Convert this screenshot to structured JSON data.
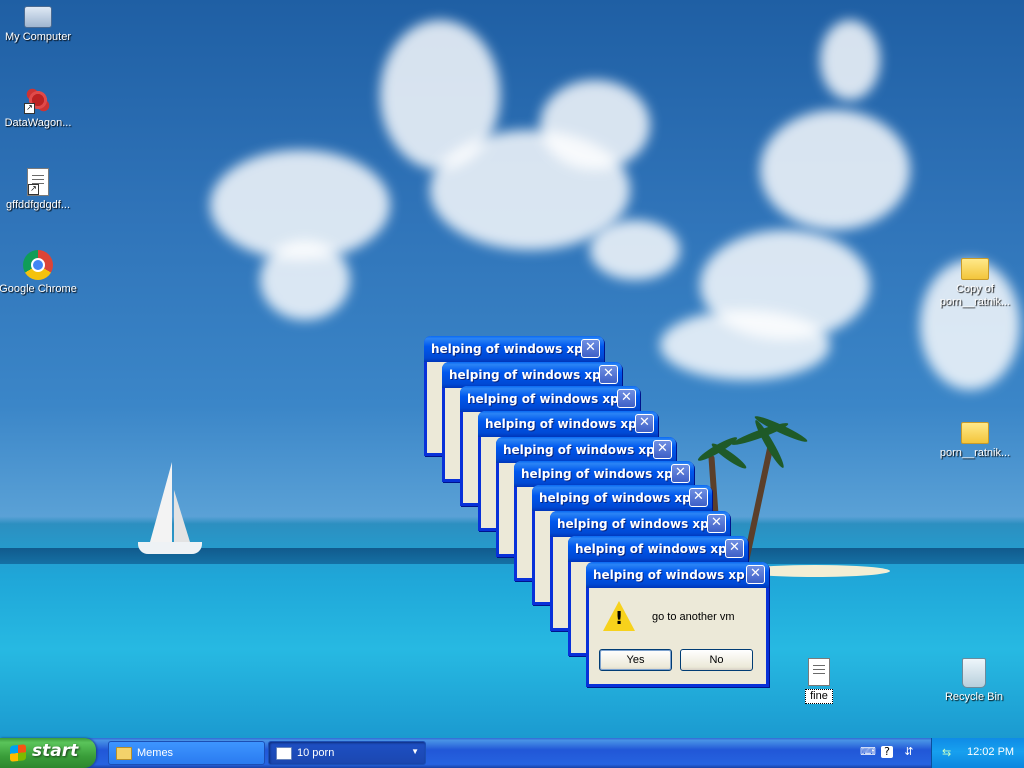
{
  "desktop": {
    "icons": [
      {
        "label": "My Computer",
        "icon": "computer-icon"
      },
      {
        "label": "DataWagon...",
        "icon": "datawagon-shortcut-icon"
      },
      {
        "label": "gffddfgdgdf...",
        "icon": "text-file-shortcut-icon"
      },
      {
        "label": "Google Chrome",
        "icon": "chrome-icon"
      },
      {
        "label": "Copy of porn__ratnik...",
        "icon": "folder-icon"
      },
      {
        "label": "porn__ratnik...",
        "icon": "folder-icon"
      },
      {
        "label": "fine",
        "icon": "text-file-icon"
      },
      {
        "label": "Recycle Bin",
        "icon": "recycle-bin-icon"
      }
    ]
  },
  "dialogs": {
    "title": "helping of windows xp",
    "close_glyph": "✕",
    "message": "go to another vm",
    "yes_label": "Yes",
    "no_label": "No",
    "icon": "warning-icon",
    "count": 10
  },
  "taskbar": {
    "start_label": "start",
    "tasks": [
      {
        "label": "Memes",
        "icon": "folder-icon"
      },
      {
        "label": "10 porn",
        "icon": "window-group-icon"
      }
    ],
    "tray_icons": [
      "keyboard-icon",
      "help-icon",
      "arrow-icon"
    ],
    "clock": "12:02 PM"
  },
  "colors": {
    "title_bar": "#0058ee",
    "dialog_body": "#ece9d8",
    "start_button": "#3a9e3a",
    "taskbar": "#2157d7"
  }
}
